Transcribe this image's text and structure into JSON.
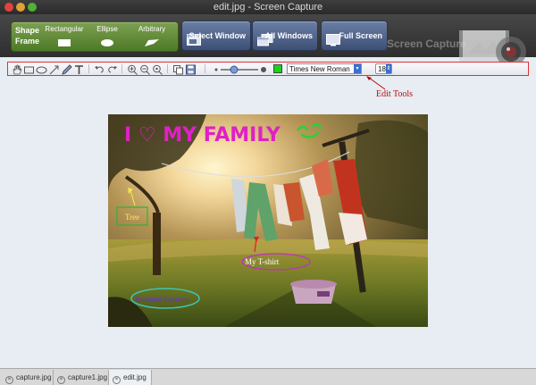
{
  "window": {
    "title": "edit.jpg - Screen Capture"
  },
  "toolbar": {
    "shape_frame_label": "Shape Frame",
    "shapes": [
      {
        "label": "Rectangular"
      },
      {
        "label": "Ellipse"
      },
      {
        "label": "Arbitrary"
      }
    ],
    "capture_buttons": [
      {
        "label": "Select Window"
      },
      {
        "label": "All Windows"
      },
      {
        "label": "Full Screen"
      }
    ],
    "brand_text": "Screen Capture"
  },
  "edit_tools": {
    "font_name": "Times New Roman",
    "font_size": "18",
    "color": "#19d219",
    "callout_label": "Edit Tools"
  },
  "image_annotations": {
    "title": "I ♡ MY FAMILY",
    "tree_label": "Tree",
    "tshirt_label": "My T-shirt",
    "sunshine_label": "Beautiful Sunshine"
  },
  "tabs": [
    {
      "label": "capture.jpg",
      "active": false
    },
    {
      "label": "capture1.jpg",
      "active": false
    },
    {
      "label": "edit.jpg",
      "active": true
    }
  ],
  "colors": {
    "accent_green": "#5d8a34",
    "accent_blue": "#4a5d86",
    "annotation_red": "#d33333"
  }
}
